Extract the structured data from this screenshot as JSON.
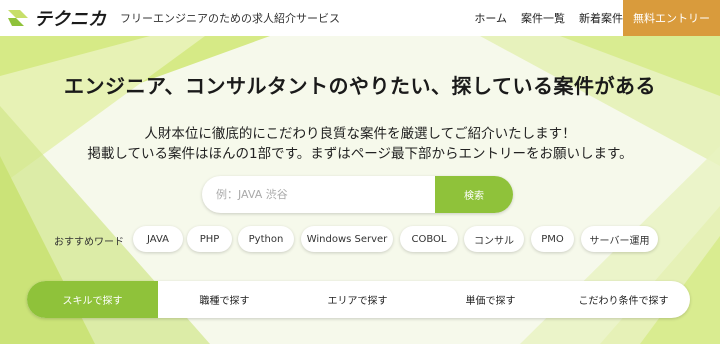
{
  "header": {
    "logo_text": "テクニカ",
    "tagline": "フリーエンジニアのための求人紹介サービス",
    "nav": [
      {
        "label": "ホーム"
      },
      {
        "label": "案件一覧"
      },
      {
        "label": "新着案件"
      }
    ],
    "cta_label": "無料エントリー"
  },
  "hero": {
    "headline": "エンジニア、コンサルタントのやりたい、探している案件がある",
    "description_lines": [
      "人財本位に徹底的にこだわり良質な案件を厳選してご紹介いたします！",
      "掲載している案件はほんの1部です。まずはページ最下部からエントリーをお願いします。"
    ]
  },
  "search": {
    "placeholder": "例：JAVA 渋谷",
    "button_label": "検索"
  },
  "keywords": {
    "label": "おすすめワード",
    "items": [
      "JAVA",
      "PHP",
      "Python",
      "Windows Server",
      "COBOL",
      "コンサル",
      "PMO",
      "サーバー運用"
    ]
  },
  "tabs": [
    {
      "label": "スキルで探す",
      "active": true
    },
    {
      "label": "職種で探す",
      "active": false
    },
    {
      "label": "エリアで探す",
      "active": false
    },
    {
      "label": "単価で探す",
      "active": false
    },
    {
      "label": "こだわり条件で探す",
      "active": false
    }
  ],
  "colors": {
    "accent_green": "#8fc23a",
    "cta_orange": "#d99b3c",
    "hero_bg": "#f6f9eb"
  }
}
